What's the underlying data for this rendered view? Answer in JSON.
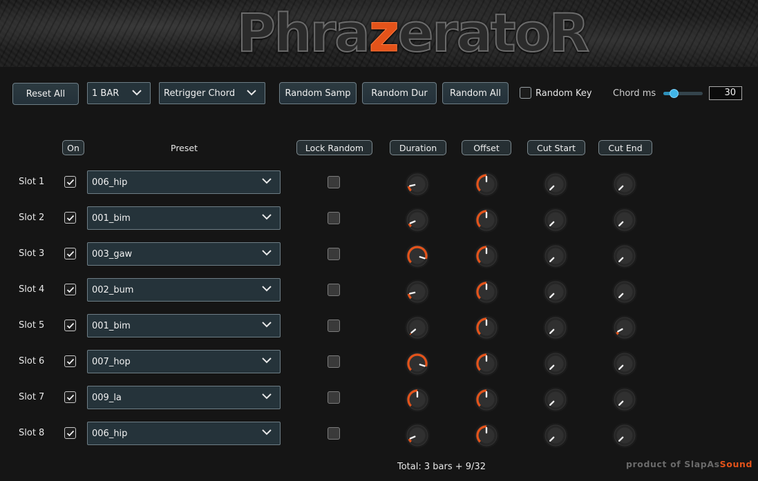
{
  "app": {
    "logo": {
      "part1": "Phra",
      "accent": "z",
      "part2": "eratoR"
    },
    "accent_color": "#e4531a"
  },
  "toolbar": {
    "reset_all": "Reset All",
    "bars_select": "1 BAR",
    "mode_select": "Retrigger Chord",
    "random_samp": "Random Samp",
    "random_dur": "Random Dur",
    "random_all": "Random All",
    "random_key_label": "Random Key",
    "random_key_checked": false,
    "chord_ms_label": "Chord ms",
    "chord_ms_value": "30",
    "chord_ms_slider_fraction": 0.27
  },
  "headers": {
    "on": "On",
    "preset": "Preset",
    "lock_random": "Lock Random",
    "duration": "Duration",
    "offset": "Offset",
    "cut_start": "Cut Start",
    "cut_end": "Cut End"
  },
  "slots": [
    {
      "label": "Slot 1",
      "on": true,
      "preset": "006_hip",
      "lock": false,
      "duration": 0.12,
      "offset": 0.5,
      "cut_start": 0.0,
      "cut_end": 0.0
    },
    {
      "label": "Slot 2",
      "on": true,
      "preset": "001_bim",
      "lock": false,
      "duration": 0.08,
      "offset": 0.5,
      "cut_start": 0.0,
      "cut_end": 0.0
    },
    {
      "label": "Slot 3",
      "on": true,
      "preset": "003_gaw",
      "lock": false,
      "duration": 0.9,
      "offset": 0.5,
      "cut_start": 0.0,
      "cut_end": 0.0
    },
    {
      "label": "Slot 4",
      "on": true,
      "preset": "002_bum",
      "lock": false,
      "duration": 0.12,
      "offset": 0.5,
      "cut_start": 0.0,
      "cut_end": 0.0
    },
    {
      "label": "Slot 5",
      "on": true,
      "preset": "001_bim",
      "lock": false,
      "duration": 0.02,
      "offset": 0.5,
      "cut_start": 0.0,
      "cut_end": 0.06
    },
    {
      "label": "Slot 6",
      "on": true,
      "preset": "007_hop",
      "lock": false,
      "duration": 0.9,
      "offset": 0.5,
      "cut_start": 0.0,
      "cut_end": 0.0
    },
    {
      "label": "Slot 7",
      "on": true,
      "preset": "009_la",
      "lock": false,
      "duration": 0.5,
      "offset": 0.5,
      "cut_start": 0.0,
      "cut_end": 0.0
    },
    {
      "label": "Slot 8",
      "on": true,
      "preset": "006_hip",
      "lock": false,
      "duration": 0.08,
      "offset": 0.5,
      "cut_start": 0.0,
      "cut_end": 0.0
    }
  ],
  "footer": {
    "total": "Total: 3 bars + 9/32",
    "brand_part1": "product of SlapAs",
    "brand_part2": "Sound"
  }
}
